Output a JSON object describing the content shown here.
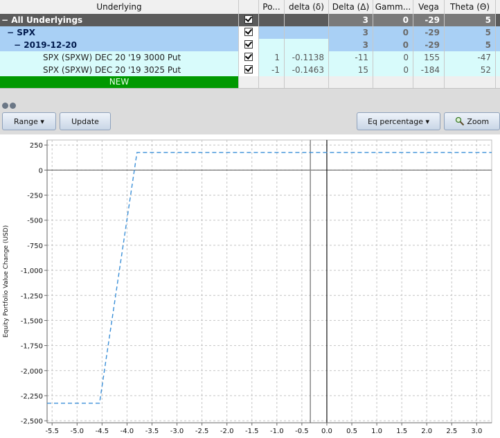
{
  "table": {
    "headers": [
      "Underlying",
      "Po...",
      "delta (δ)",
      "Delta (Δ)",
      "Gamm...",
      "Vega",
      "Theta (Θ)"
    ],
    "rows": [
      {
        "label": "All Underlyings",
        "delta_cap": "3",
        "gamma": "0",
        "vega": "-29",
        "theta": "5"
      },
      {
        "label": "SPX",
        "delta_cap": "3",
        "gamma": "0",
        "vega": "-29",
        "theta": "5"
      },
      {
        "label": "2019-12-20",
        "delta_cap": "3",
        "gamma": "0",
        "vega": "-29",
        "theta": "5"
      },
      {
        "label": "SPX (SPXW) DEC 20 '19 3000 Put",
        "pos": "1",
        "delta": "-0.1138",
        "delta_cap": "-11",
        "gamma": "0",
        "vega": "155",
        "theta": "-47"
      },
      {
        "label": "SPX (SPXW) DEC 20 '19 3025 Put",
        "pos": "-1",
        "delta": "-0.1463",
        "delta_cap": "15",
        "gamma": "0",
        "vega": "-184",
        "theta": "52"
      }
    ],
    "new_label": "NEW",
    "collapse_glyph": "−"
  },
  "toolbar": {
    "range_label": "Range",
    "update_label": "Update",
    "eq_label": "Eq percentage",
    "zoom_label": "Zoom",
    "dropdown_glyph": "▾",
    "zoom_icon": "zoom-icon"
  },
  "chart_data": {
    "type": "line",
    "xlabel": "",
    "ylabel": "Equity Portfolio Value Change (USD)",
    "xlim": [
      -5.6,
      3.3
    ],
    "ylim": [
      -2520,
      300
    ],
    "x_ticks": [
      -5.5,
      -5.0,
      -4.5,
      -4.0,
      -3.5,
      -3.0,
      -2.5,
      -2.0,
      -1.5,
      -1.0,
      -0.5,
      0.0,
      0.5,
      1.0,
      1.5,
      2.0,
      2.5,
      3.0
    ],
    "x_tick_labels": [
      "-5.5",
      "-5.0",
      "-4.5",
      "-4.0",
      "-3.5",
      "-3.0",
      "-2.5",
      "-2.0",
      "-1.5",
      "-1.0",
      "-0.5",
      "0.0",
      "0.5",
      "1.0",
      "1.5",
      "2.0",
      "2.5",
      "3.0"
    ],
    "y_ticks": [
      250,
      0,
      -250,
      -500,
      -750,
      -1000,
      -1250,
      -1500,
      -1750,
      -2000,
      -2250,
      -2500
    ],
    "y_tick_labels": [
      "250",
      "0",
      "-250",
      "-500",
      "-750",
      "-1,000",
      "-1,250",
      "-1,500",
      "-1,750",
      "-2,000",
      "-2,250",
      "-2,500"
    ],
    "grid": true,
    "vertical_markers": [
      -0.33,
      0.0
    ],
    "series": [
      {
        "color": "#3a8fd8",
        "dash": true,
        "x": [
          -5.6,
          -4.55,
          -3.8,
          -3.8,
          3.3
        ],
        "y": [
          -2325,
          -2325,
          175,
          175,
          175
        ]
      }
    ]
  }
}
